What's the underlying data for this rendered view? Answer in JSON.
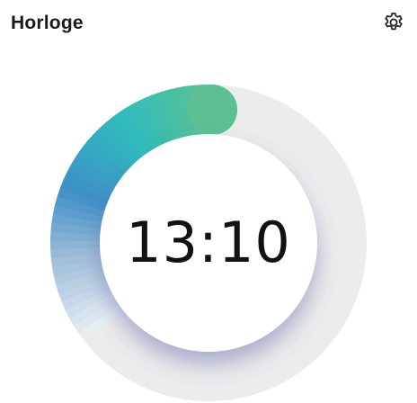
{
  "header": {
    "title": "Horloge",
    "settings_icon": "gear-icon"
  },
  "clock": {
    "time": "13:10",
    "progress_fraction": 0.36
  },
  "colors": {
    "ring_start": "#9cbbd8",
    "ring_mid": "#3f8fc8",
    "ring_teal": "#2fbcbc",
    "ring_end": "#5cc094",
    "track": "#ececec",
    "text": "#111111"
  }
}
